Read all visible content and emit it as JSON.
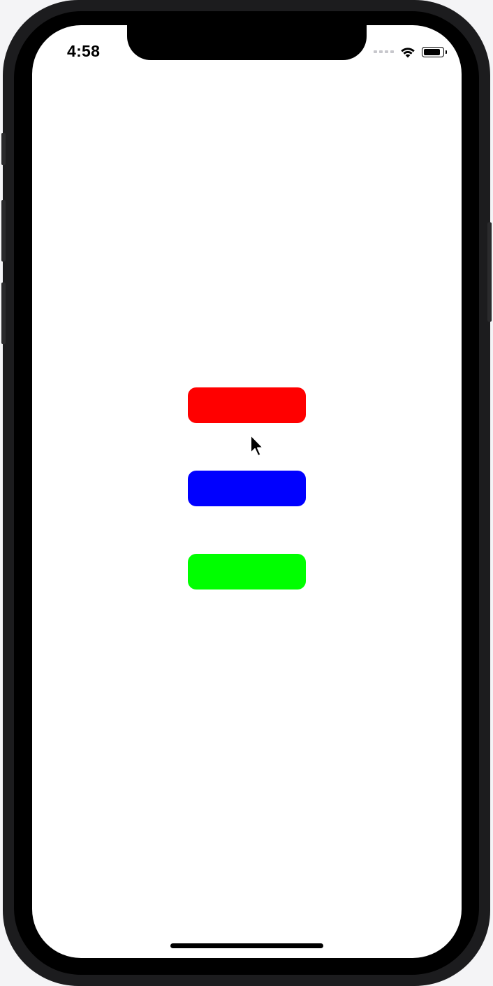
{
  "status_bar": {
    "time": "4:58",
    "signal_icon": "cellular-signal-icon",
    "wifi_icon": "wifi-icon",
    "battery_icon": "battery-icon",
    "battery_level": 0.9
  },
  "buttons": [
    {
      "name": "red-button",
      "label": "",
      "color": "#FF0000"
    },
    {
      "name": "blue-button",
      "label": "",
      "color": "#0000FF"
    },
    {
      "name": "green-button",
      "label": "",
      "color": "#00FF00"
    }
  ],
  "home_indicator": {
    "icon": "home-indicator"
  },
  "cursor": {
    "icon": "mouse-pointer-icon"
  },
  "colors": {
    "screen_background": "#FFFFFF",
    "device_frame": "#1C1C1E",
    "bezel": "#000000"
  }
}
